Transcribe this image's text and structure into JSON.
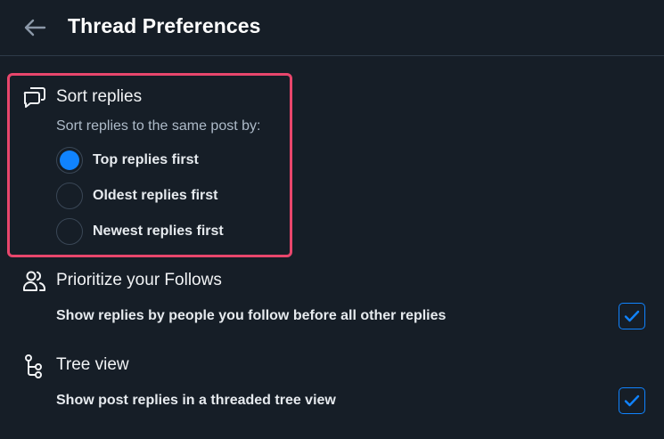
{
  "header": {
    "title": "Thread Preferences",
    "back_icon": "arrow-left-icon"
  },
  "sort_replies": {
    "icon": "chat-bubbles-icon",
    "title": "Sort replies",
    "subtitle": "Sort replies to the same post by:",
    "options": [
      {
        "label": "Top replies first",
        "selected": true
      },
      {
        "label": "Oldest replies first",
        "selected": false
      },
      {
        "label": "Newest replies first",
        "selected": false
      }
    ]
  },
  "prioritize_follows": {
    "icon": "people-icon",
    "title": "Prioritize your Follows",
    "description": "Show replies by people you follow before all other replies",
    "checked": true
  },
  "tree_view": {
    "icon": "tree-icon",
    "title": "Tree view",
    "description": "Show post replies in a threaded tree view",
    "checked": true
  },
  "colors": {
    "background": "#161e27",
    "accent": "#1083fe",
    "highlight_border": "#e8466c"
  }
}
